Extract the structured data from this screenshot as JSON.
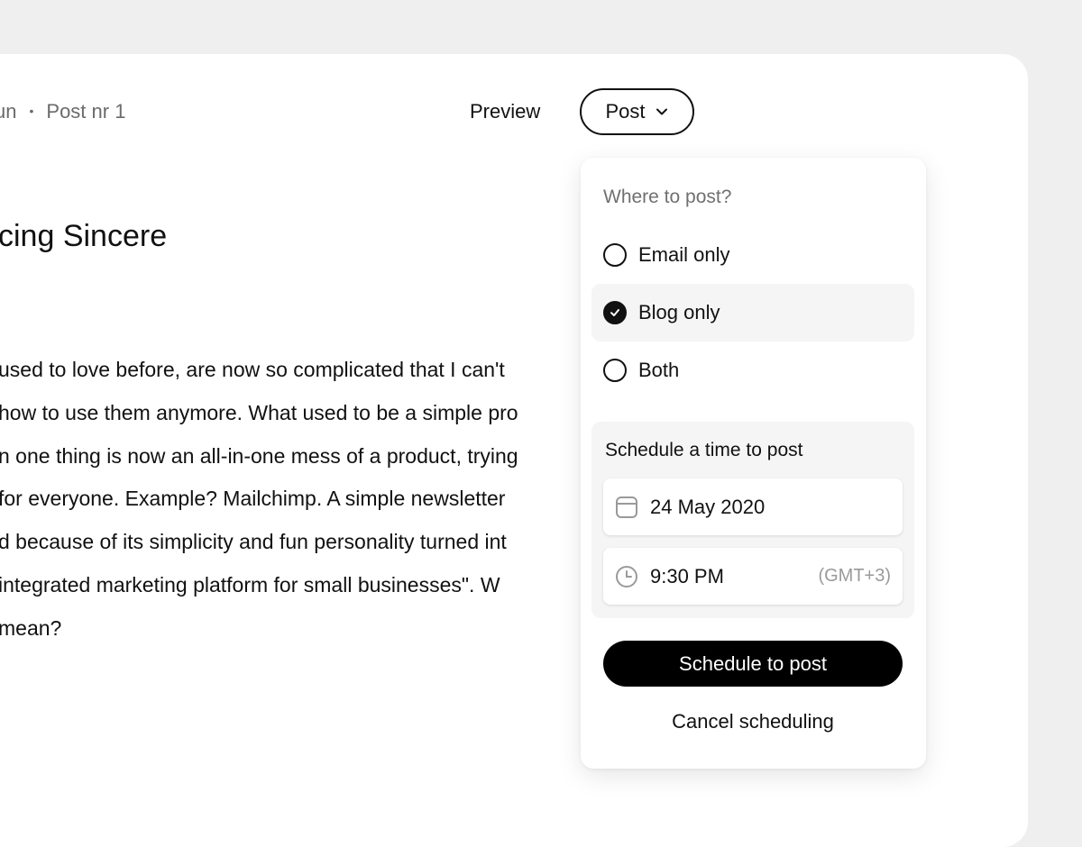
{
  "header": {
    "breadcrumb_part1": "un",
    "breadcrumb_separator": "•",
    "breadcrumb_part2": "Post nr 1",
    "preview_label": "Preview",
    "post_label": "Post"
  },
  "article": {
    "title": "cing Sincere",
    "lines": [
      "used to love before, are now so complicated that I can't",
      "how to use them anymore. What used to be a simple pro",
      "n one thing is now an all-in-one mess of a product, trying",
      " for everyone. Example? Mailchimp. A simple newsletter",
      "d because of its simplicity and fun personality turned int",
      " integrated marketing platform for small businesses\". W",
      "mean?"
    ]
  },
  "dropdown": {
    "heading": "Where to post?",
    "options": [
      {
        "label": "Email only",
        "selected": false
      },
      {
        "label": "Blog only",
        "selected": true
      },
      {
        "label": "Both",
        "selected": false
      }
    ],
    "schedule": {
      "label": "Schedule a time to post",
      "date": "24 May 2020",
      "time": "9:30 PM",
      "timezone": "(GMT+3)"
    },
    "schedule_button": "Schedule to post",
    "cancel_button": "Cancel scheduling"
  },
  "icons": {
    "post_chevron": "chevron-down-icon",
    "checked_radio": "check-icon",
    "date_field": "calendar-icon",
    "time_field": "clock-icon"
  },
  "colors": {
    "background": "#efefef",
    "card": "#ffffff",
    "primary": "#000000",
    "muted_text": "#6b6b6b",
    "selected_bg": "#f5f5f5"
  }
}
